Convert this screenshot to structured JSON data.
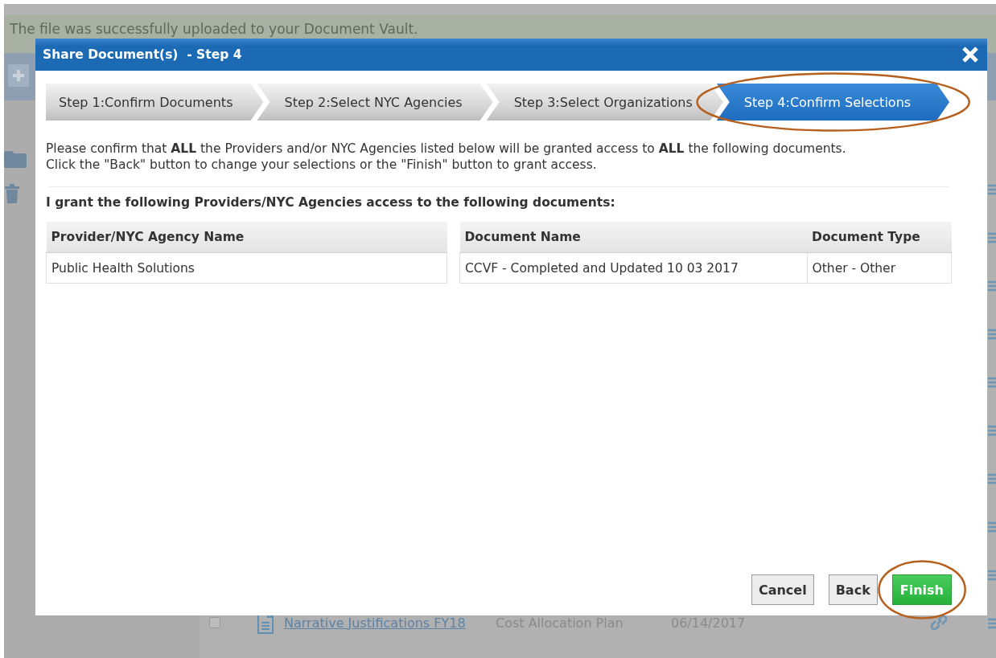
{
  "background": {
    "banner": "The file was successfully uploaded to your Document Vault.",
    "rows": [
      {
        "kind": "hidden"
      },
      {
        "kind": "hidden"
      },
      {
        "kind": "hidden"
      },
      {
        "kind": "hidden"
      },
      {
        "kind": "hidden"
      },
      {
        "kind": "hidden"
      },
      {
        "kind": "hidden"
      },
      {
        "kind": "hidden"
      },
      {
        "kind": "hidden"
      },
      {
        "kind": "document",
        "checked": false,
        "name": "Narrative Justifications FY18",
        "type": "Cost Allocation Plan",
        "date": "06/14/2017"
      }
    ]
  },
  "dialog": {
    "title": "Share Document(s)  - Step 4",
    "steps": [
      {
        "label": "Step 1:Confirm Documents",
        "selected": false,
        "circled": false
      },
      {
        "label": "Step 2:Select NYC Agencies",
        "selected": false,
        "circled": false
      },
      {
        "label": "Step 3:Select Organizations",
        "selected": false,
        "circled": false
      },
      {
        "label": "Step 4:Confirm Selections",
        "selected": true,
        "circled": true
      }
    ],
    "intro_lines": [
      "Please confirm that **ALL** the Providers and/or NYC Agencies listed below will be granted access to **ALL** the following documents.",
      "Click the \"Back\" button to change your selections or the \"Finish\" button to grant access."
    ],
    "heading": "I grant the following Providers/NYC Agencies access to the following documents:",
    "providers": {
      "columns": [
        "Provider/NYC Agency Name"
      ],
      "rows": [
        [
          "Public Health Solutions"
        ]
      ]
    },
    "documents": {
      "columns": [
        "Document Name",
        "Document Type"
      ],
      "rows": [
        [
          "CCVF - Completed and Updated 10 03 2017",
          "Other - Other"
        ]
      ]
    },
    "buttons": [
      {
        "label": "Cancel",
        "kind": "default",
        "circled": false
      },
      {
        "label": "Back",
        "kind": "default",
        "circled": false
      },
      {
        "label": "Finish",
        "kind": "primary",
        "circled": true
      }
    ]
  }
}
